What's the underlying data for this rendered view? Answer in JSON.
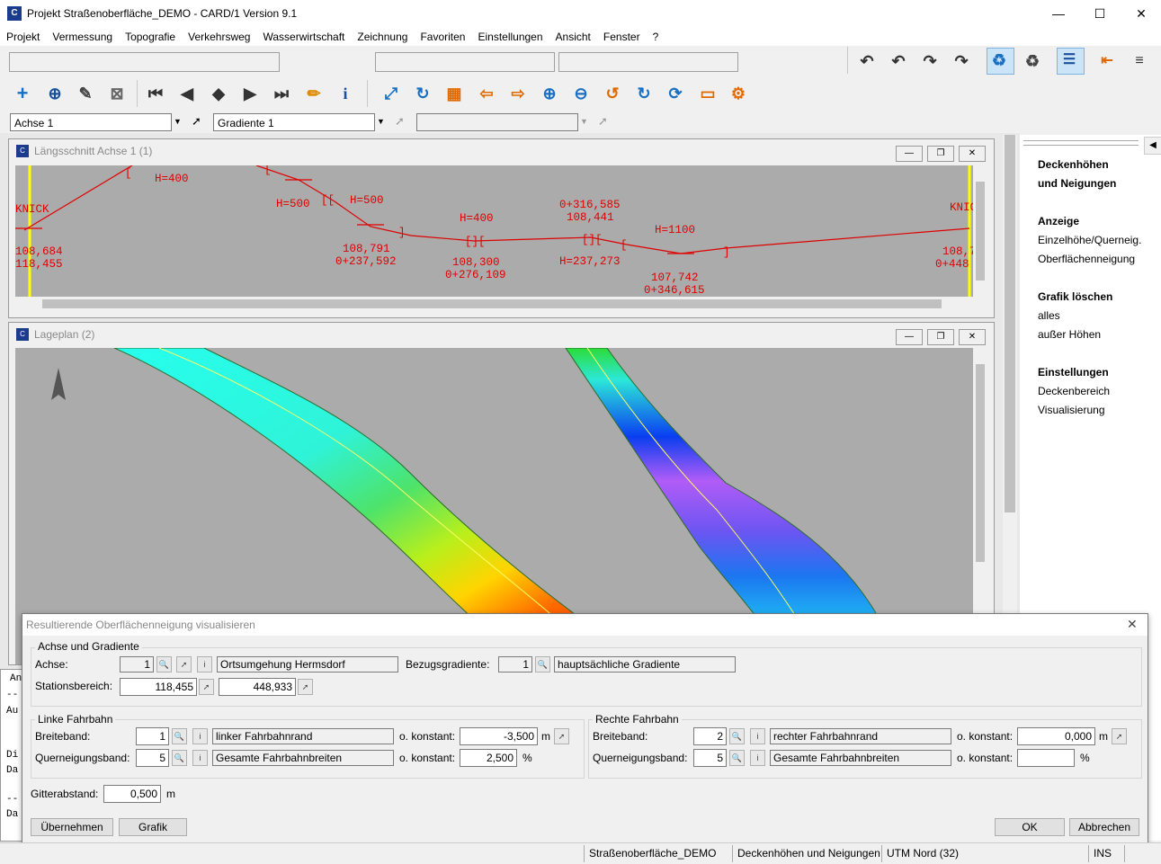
{
  "window": {
    "title": "Projekt Straßenoberfläche_DEMO - CARD/1 Version 9.1",
    "minimize": "—",
    "maximize": "☐",
    "close": "✕"
  },
  "menu": [
    "Projekt",
    "Vermessung",
    "Topografie",
    "Verkehrsweg",
    "Wasserwirtschaft",
    "Zeichnung",
    "Favoriten",
    "Einstellungen",
    "Ansicht",
    "Fenster",
    "?"
  ],
  "toolbar": {
    "axis_combo": "Achse 1",
    "gradient_combo": "Gradiente 1"
  },
  "profile_window": {
    "title": "Längsschnitt Achse 1 (1)",
    "labels": {
      "knick_left": "KNICK",
      "knick_right": "KNIC",
      "h400a": "H=400",
      "h500a": "H=500",
      "h500b": "H=500",
      "h400b": "H=400",
      "h1100": "H=1100",
      "left_elev": "108,684",
      "left_station": "118,455",
      "p1_elev": "108,791",
      "p1_station": "0+237,592",
      "p2_elev": "108,300",
      "p2_station": "0+276,109",
      "p3_station": "0+316,585",
      "p3_elev": "108,441",
      "p3_h": "H=237,273",
      "p4_elev": "107,742",
      "p4_station": "0+346,615",
      "right_elev": "108,7",
      "right_station": "0+448"
    }
  },
  "plan_window": {
    "title": "Lageplan (2)"
  },
  "right_panel": {
    "title1": "Deckenhöhen",
    "title2": "und Neigungen",
    "anzeige": "Anzeige",
    "einzel": "Einzelhöhe/Querneig.",
    "oberflaeche": "Oberflächenneigung",
    "grafik": "Grafik löschen",
    "alles": "alles",
    "ausser": "außer Höhen",
    "einstellungen": "Einstellungen",
    "deckenbereich": "Deckenbereich",
    "visualisierung": "Visualisierung"
  },
  "console": {
    "lines": [
      "An",
      "--",
      "Au",
      "Di",
      "Da",
      "--",
      "Da"
    ]
  },
  "dialog": {
    "title": "Resultierende Oberflächenneigung visualisieren",
    "group1": "Achse und Gradiente",
    "achse_label": "Achse:",
    "achse_nr": "1",
    "achse_name": "Ortsumgehung Hermsdorf",
    "bezug_label": "Bezugsgradiente:",
    "bezug_nr": "1",
    "bezug_name": "hauptsächliche Gradiente",
    "station_label": "Stationsbereich:",
    "station_from": "118,455",
    "station_to": "448,933",
    "left_group": "Linke Fahrbahn",
    "right_group": "Rechte Fahrbahn",
    "breite_label": "Breiteband:",
    "quer_label": "Querneigungsband:",
    "konst_label": "o. konstant:",
    "left_breite_nr": "1",
    "left_breite_name": "linker Fahrbahnrand",
    "left_breite_val": "-3,500",
    "left_quer_nr": "5",
    "left_quer_name": "Gesamte Fahrbahnbreiten",
    "left_quer_val": "2,500",
    "right_breite_nr": "2",
    "right_breite_name": "rechter Fahrbahnrand",
    "right_breite_val": "0,000",
    "right_quer_nr": "5",
    "right_quer_name": "Gesamte Fahrbahnbreiten",
    "right_quer_val": "",
    "unit_m": "m",
    "unit_pct": "%",
    "gitter_label": "Gitterabstand:",
    "gitter_val": "0,500",
    "btn_apply": "Übernehmen",
    "btn_grafik": "Grafik",
    "btn_ok": "OK",
    "btn_cancel": "Abbrechen"
  },
  "status": {
    "project": "Straßenoberfläche_DEMO",
    "mode": "Deckenhöhen und Neigungen",
    "crs": "UTM Nord (32)",
    "ins": "INS"
  }
}
